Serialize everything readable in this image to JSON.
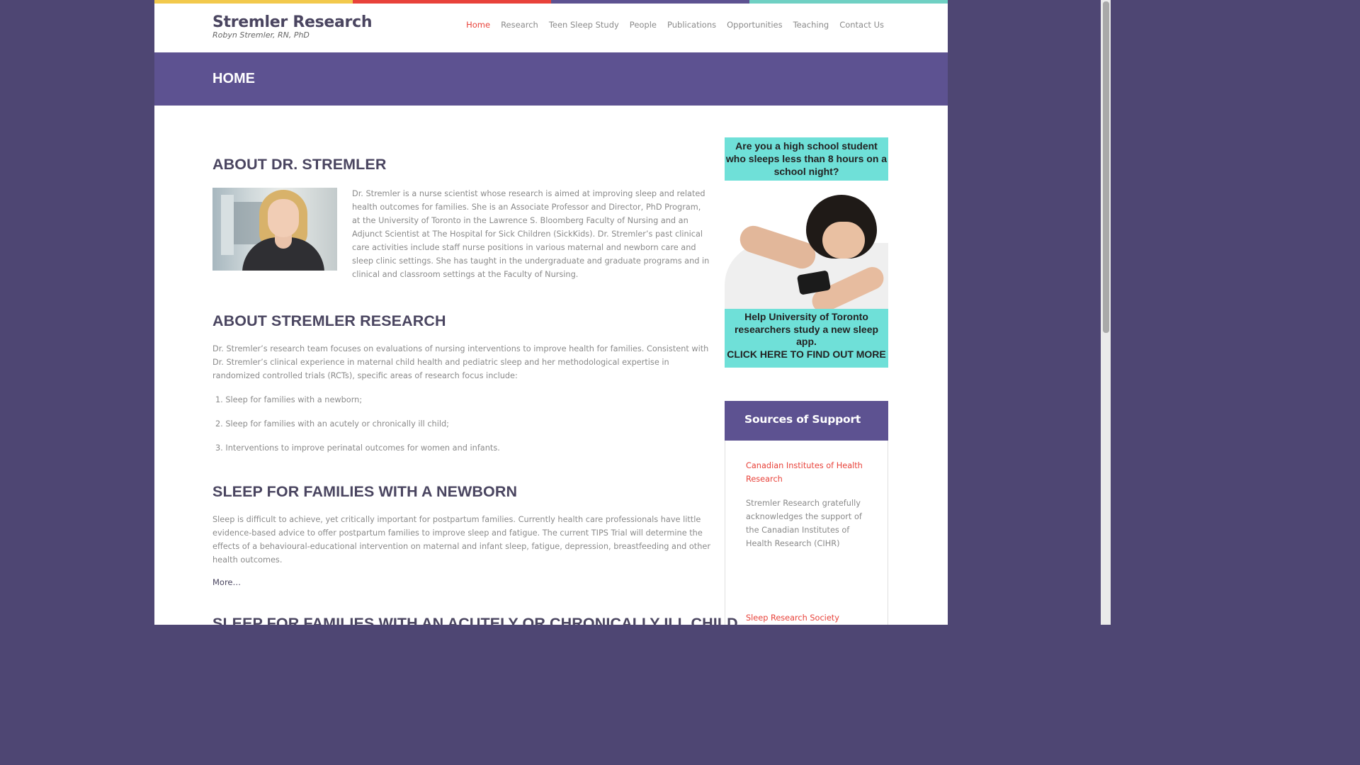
{
  "colors": {
    "stripe1": "#f2c94c",
    "stripe2": "#e8423a",
    "stripe3": "#5d5291",
    "stripe4": "#6fd0c3"
  },
  "site": {
    "title": "Stremler Research",
    "subtitle": "Robyn Stremler, RN, PhD"
  },
  "nav": [
    {
      "label": "Home",
      "active": true
    },
    {
      "label": "Research"
    },
    {
      "label": "Teen Sleep Study"
    },
    {
      "label": "People"
    },
    {
      "label": "Publications"
    },
    {
      "label": "Opportunities"
    },
    {
      "label": "Teaching"
    },
    {
      "label": "Contact Us"
    }
  ],
  "banner": {
    "title": "HOME"
  },
  "main": {
    "about_heading": "ABOUT DR. STREMLER",
    "about_text": "Dr. Stremler is a nurse scientist whose research is aimed at improving sleep and related health outcomes for families. She is an Associate Professor and Director, PhD Program, at the University of Toronto in the Lawrence S. Bloomberg Faculty of Nursing and an Adjunct Scientist at The Hospital for Sick Children (SickKids). Dr. Stremler’s past clinical care activities include staff nurse positions in various maternal and newborn care and sleep clinic settings. She has taught in the undergraduate and graduate programs and in clinical and classroom settings at the Faculty of Nursing.",
    "research_heading": "ABOUT STREMLER RESEARCH",
    "research_text": "Dr. Stremler’s research team focuses on evaluations of nursing interventions to improve health for families. Consistent with Dr. Stremler’s clinical experience in maternal child health and pediatric sleep and her methodological expertise in randomized controlled trials (RCTs), specific areas of research focus include:",
    "focus_list": [
      "1. Sleep for families with a newborn;",
      "2. Sleep for families with an acutely or chronically ill child;",
      "3. Interventions to improve perinatal outcomes for women and infants."
    ],
    "newborn_heading": "SLEEP FOR FAMILIES WITH A NEWBORN",
    "newborn_text": "Sleep is difficult to achieve, yet critically important for postpartum families. Currently health care professionals have little evidence-based advice to offer postpartum families to improve sleep and fatigue. The current TIPS Trial will determine the effects of a behavioural-educational intervention on maternal and infant sleep, fatigue, depression, breastfeeding and other health outcomes.",
    "more_label": "More…",
    "ill_child_heading": "SLEEP FOR FAMILIES WITH AN ACUTELY OR CHRONICALLY ILL CHILD"
  },
  "ad": {
    "top_text": "Are you a high school student who sleeps less than 8 hours on a school night?",
    "bottom_text": "Help University of Toronto researchers study a new sleep app.",
    "cta": "CLICK HERE TO FIND OUT MORE"
  },
  "support": {
    "heading": "Sources of Support",
    "cihr_link": "Canadian Institutes of Health Research",
    "cihr_text": "Stremler Research gratefully acknowledges the support of the Canadian Institutes of Health Research (CIHR)",
    "srs_link": "Sleep Research Society"
  }
}
